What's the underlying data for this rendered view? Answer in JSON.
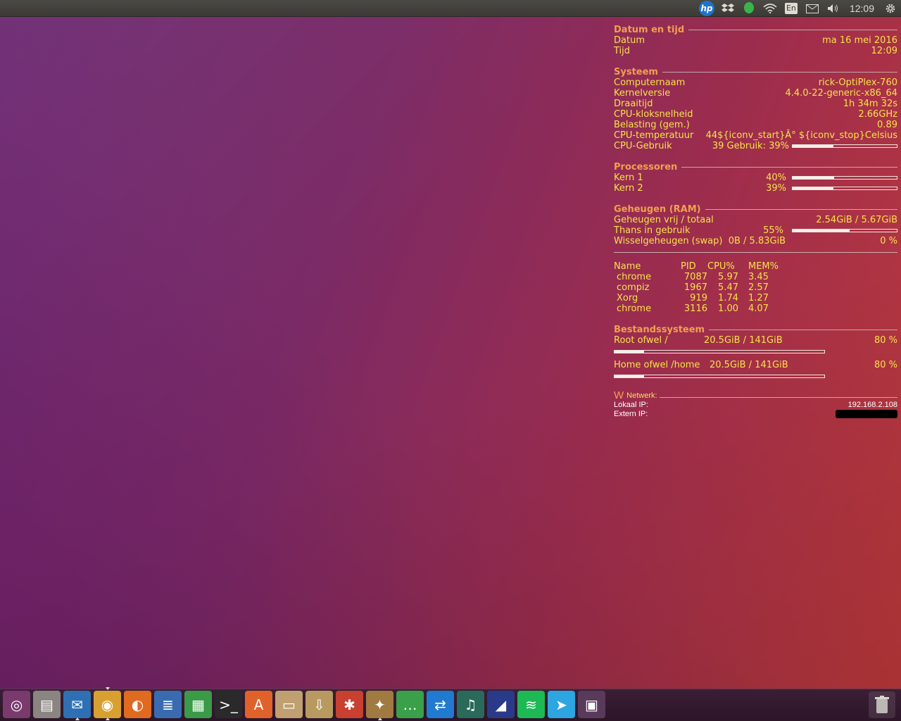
{
  "panel": {
    "clock": "12:09",
    "keyboard_layout": "En",
    "indicators": [
      "hp-icon",
      "dropbox-icon",
      "evernote-icon",
      "wifi-icon",
      "keyboard-layout",
      "mail-icon",
      "volume-icon",
      "clock",
      "power-gear-icon"
    ]
  },
  "conky": {
    "datetime": {
      "title": "Datum en tijd",
      "date_label": "Datum",
      "date_value": "ma 16 mei 2016",
      "time_label": "Tijd",
      "time_value": "12:09"
    },
    "system": {
      "title": "Systeem",
      "hostname_label": "Computernaam",
      "hostname_value": "rick-OptiPlex-760",
      "kernel_label": "Kernelversie",
      "kernel_value": "4.4.0-22-generic-x86_64",
      "uptime_label": "Draaitijd",
      "uptime_value": "1h 34m 32s",
      "freq_label": "CPU-kloksnelheid",
      "freq_value": "2.66GHz",
      "load_label": "Belasting (gem.)",
      "load_value": "0.89",
      "temp_label": "CPU-temperatuur",
      "temp_value": "44${iconv_start}Â° ${iconv_stop}Celsius",
      "cpu_label": "CPU-Gebruik",
      "cpu_value": "39 Gebruik: 39%",
      "cpu_fraction": 0.39
    },
    "processors": {
      "title": "Processoren",
      "cores": [
        {
          "label": "Kern 1",
          "pct": "40%",
          "fraction": 0.4
        },
        {
          "label": "Kern 2",
          "pct": "39%",
          "fraction": 0.39
        }
      ]
    },
    "memory": {
      "title": "Geheugen (RAM)",
      "free_label": "Geheugen vrij / totaal",
      "free_value": "2.54GiB / 5.67GiB",
      "used_label": "Thans in gebruik",
      "used_pct": "55%",
      "used_fraction": 0.55,
      "swap_label": "Wisselgeheugen (swap)",
      "swap_value": "0B   / 5.83GiB",
      "swap_pct": "0 %"
    },
    "top": {
      "headers": [
        "Name",
        "PID",
        "CPU%",
        "MEM%"
      ],
      "rows": [
        [
          "chrome",
          "7087",
          "5.97",
          "3.45"
        ],
        [
          "compiz",
          "1967",
          "5.47",
          "2.57"
        ],
        [
          "Xorg",
          "919",
          "1.74",
          "1.27"
        ],
        [
          "chrome",
          "3116",
          "1.00",
          "4.07"
        ]
      ]
    },
    "filesystem": {
      "title": "Bestandssysteem",
      "root_label": "Root ofwel /",
      "root_value": "20.5GiB / 141GiB",
      "root_pct": "80 %",
      "root_fraction": 0.14,
      "home_label": "Home ofwel /home",
      "home_value": "20.5GiB / 141GiB",
      "home_pct": "80 %",
      "home_fraction": 0.14
    },
    "network": {
      "glyph": "W",
      "title": "Netwerk:",
      "local_label": "Lokaal IP:",
      "local_value": "192.168.2.108",
      "external_label": "Extern IP:"
    }
  },
  "dock": {
    "items": [
      {
        "name": "ubuntu-launcher-icon",
        "glyph": "◎",
        "color": "#7a3a6e"
      },
      {
        "name": "files-icon",
        "glyph": "▤",
        "color": "#8a8580"
      },
      {
        "name": "thunderbird-icon",
        "glyph": "✉",
        "color": "#2f6fb3"
      },
      {
        "name": "chrome-icon",
        "glyph": "◉",
        "color": "#d8a030"
      },
      {
        "name": "firefox-icon",
        "glyph": "◐",
        "color": "#e06a20"
      },
      {
        "name": "writer-icon",
        "glyph": "≣",
        "color": "#3a6bb0"
      },
      {
        "name": "calc-icon",
        "glyph": "▦",
        "color": "#3a9a48"
      },
      {
        "name": "terminal-icon",
        "glyph": ">_",
        "color": "#2a2a2a"
      },
      {
        "name": "software-center-icon",
        "glyph": "A",
        "color": "#e0622a"
      },
      {
        "name": "archive-icon",
        "glyph": "▭",
        "color": "#c0a070"
      },
      {
        "name": "download-icon",
        "glyph": "⇩",
        "color": "#b89a60"
      },
      {
        "name": "settings-tools-icon",
        "glyph": "✱",
        "color": "#c84030"
      },
      {
        "name": "system-tools-icon",
        "glyph": "✦",
        "color": "#a07a40"
      },
      {
        "name": "chat-icon",
        "glyph": "…",
        "color": "#3aa04a"
      },
      {
        "name": "teamviewer-icon",
        "glyph": "⇄",
        "color": "#1f7ad0"
      },
      {
        "name": "music-icon",
        "glyph": "♫",
        "color": "#2a6a5a"
      },
      {
        "name": "vpn-shield-icon",
        "glyph": "◢",
        "color": "#2a3a8a"
      },
      {
        "name": "spotify-icon",
        "glyph": "≋",
        "color": "#1db954"
      },
      {
        "name": "telegram-icon",
        "glyph": "➤",
        "color": "#2ca5e0"
      },
      {
        "name": "workspace-switcher-icon",
        "glyph": "▣",
        "color": "#5a3a5a"
      }
    ]
  }
}
